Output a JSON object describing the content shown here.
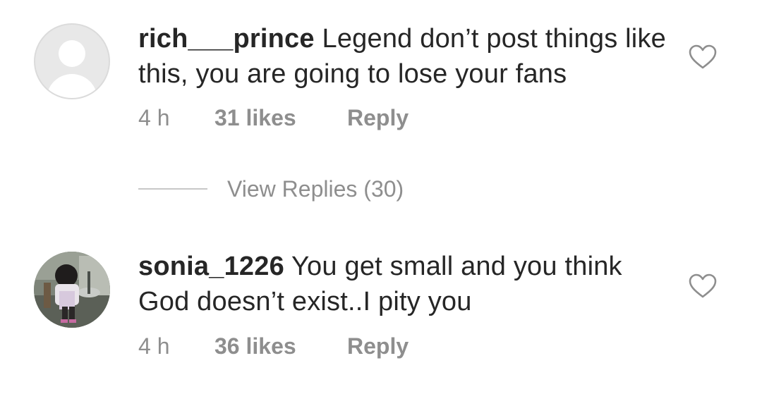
{
  "comments": [
    {
      "username": "rich___prince",
      "text": "Legend don’t post things like this, you are going to lose your fans",
      "time": "4 h",
      "likes": "31 likes",
      "reply": "Reply",
      "avatar": "default-avatar-icon"
    },
    {
      "username": "sonia_1226",
      "text": "You get small and you think God doesn’t exist..I pity you",
      "time": "4 h",
      "likes": "36 likes",
      "reply": "Reply",
      "avatar": "profile-photo"
    }
  ],
  "view_replies": "View Replies (30)",
  "colors": {
    "text": "#262626",
    "secondary": "#8e8e8e",
    "divider": "#c7c7c7"
  },
  "icons": {
    "like": "heart-outline-icon"
  }
}
